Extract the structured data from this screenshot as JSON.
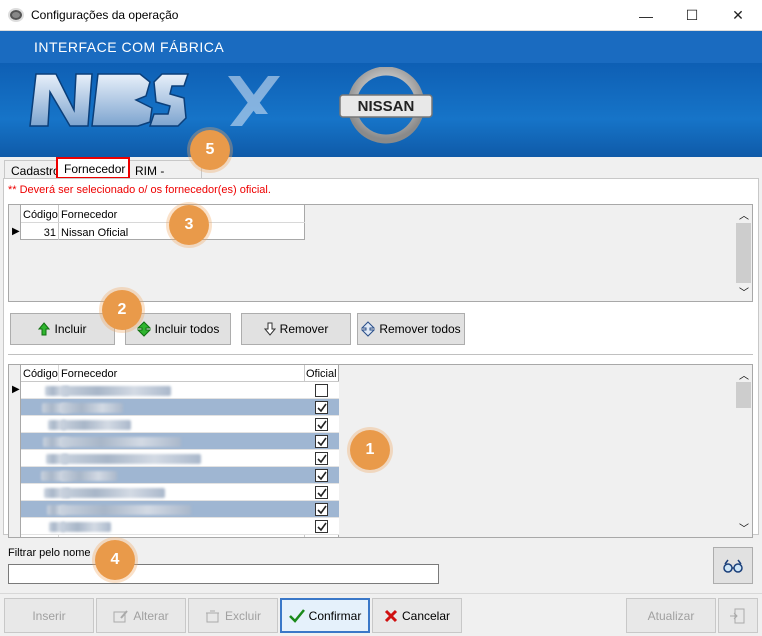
{
  "window": {
    "title": "Configurações da operação",
    "minimize": "—",
    "maximize": "☐",
    "close": "✕"
  },
  "banner": {
    "title": "INTERFACE COM FÁBRICA",
    "nbs_logo": "NBS",
    "nissan_logo": "NISSAN"
  },
  "tabs": [
    {
      "label": "Cadastro",
      "active": false
    },
    {
      "label": "Fornecedor",
      "active": true
    },
    {
      "label": "RIM - Pedidos",
      "active": false
    }
  ],
  "warning": "** Deverá ser selecionado o/ os fornecedor(es) oficial.",
  "selected_grid": {
    "headers": {
      "code": "Código",
      "supplier": "Fornecedor"
    },
    "rows": [
      {
        "code": "31",
        "supplier": "Nissan Oficial"
      }
    ]
  },
  "actions": {
    "include": "Incluir",
    "include_all": "Incluir todos",
    "remove": "Remover",
    "remove_all": "Remover todos"
  },
  "available_grid": {
    "headers": {
      "code": "Código",
      "supplier": "Fornecedor",
      "official": "Oficial"
    },
    "rows": [
      {
        "official": false,
        "highlight": false
      },
      {
        "official": true,
        "highlight": true
      },
      {
        "official": true,
        "highlight": false
      },
      {
        "official": true,
        "highlight": true
      },
      {
        "official": true,
        "highlight": false
      },
      {
        "official": true,
        "highlight": true
      },
      {
        "official": true,
        "highlight": false
      },
      {
        "official": true,
        "highlight": true
      },
      {
        "official": true,
        "highlight": false
      }
    ]
  },
  "filter": {
    "label": "Filtrar pelo nome",
    "value": ""
  },
  "annotations": [
    "1",
    "2",
    "3",
    "4",
    "5"
  ],
  "toolbar": {
    "insert": "Inserir",
    "edit": "Alterar",
    "delete": "Excluir",
    "confirm": "Confirmar",
    "cancel": "Cancelar",
    "refresh": "Atualizar"
  },
  "colors": {
    "banner": "#1a6bc0",
    "highlight_row": "#9fb6d2",
    "warning": "#e00000",
    "badge": "#e99a4a"
  }
}
